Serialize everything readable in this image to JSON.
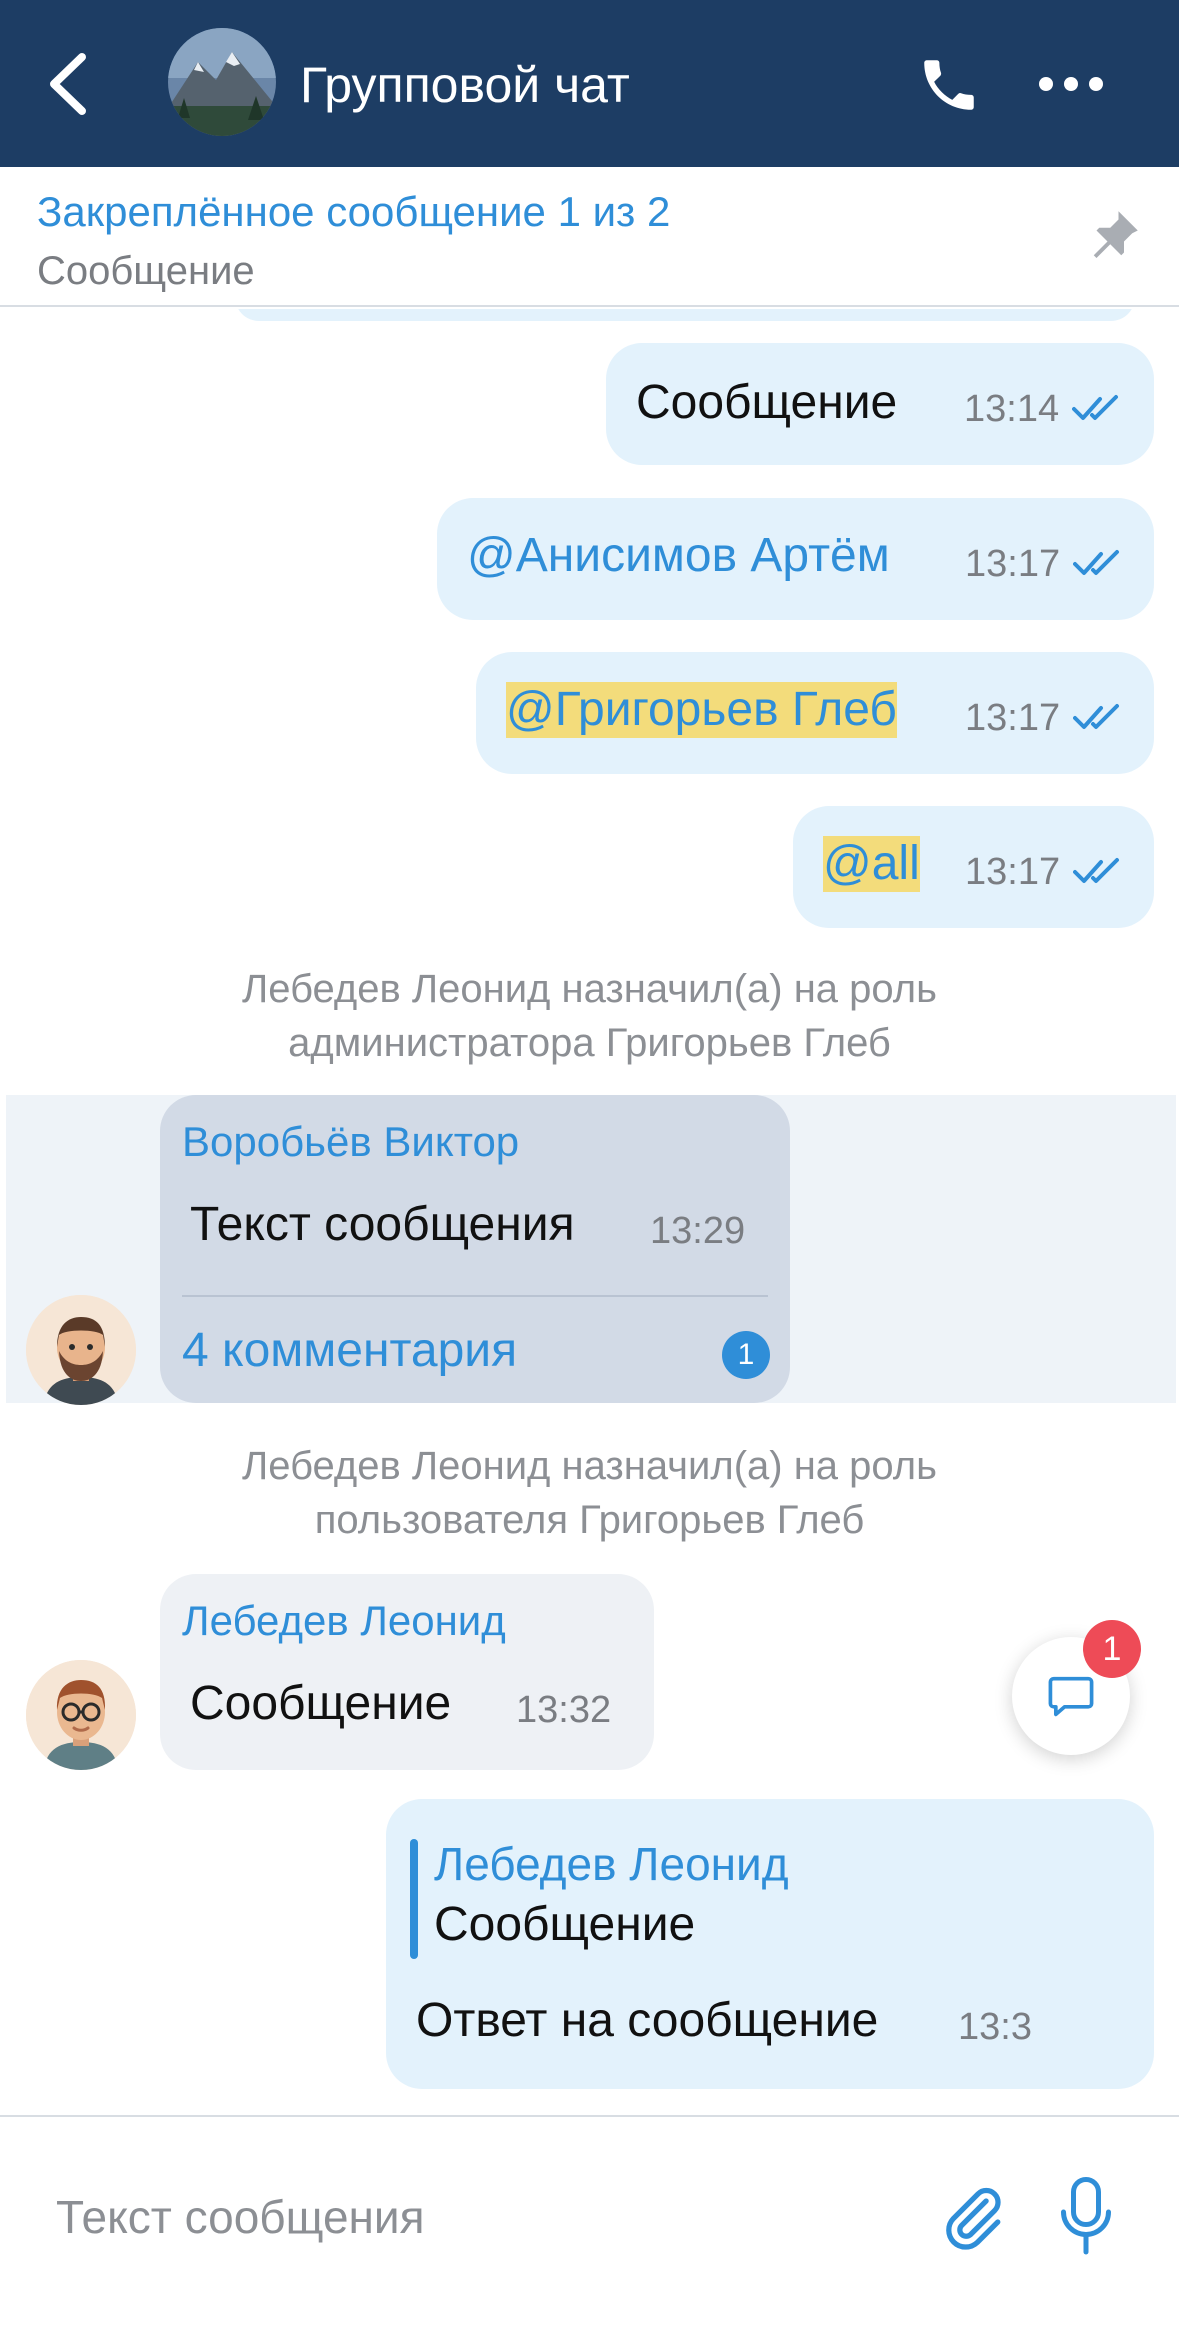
{
  "header": {
    "title": "Групповой чат",
    "back_icon": "chevron-left-icon",
    "call_icon": "phone-icon",
    "more_icon": "more-dots-icon"
  },
  "pinned": {
    "title": "Закреплённое сообщение 1 из 2",
    "text": "Сообщение",
    "icon": "pin-icon"
  },
  "messages": {
    "m1": {
      "text": "Сообщение",
      "time": "13:14"
    },
    "m2": {
      "text": "@Анисимов Артём",
      "time": "13:17"
    },
    "m3": {
      "text": "@Григорьев Глеб",
      "time": "13:17"
    },
    "m4": {
      "text": "@all",
      "time": "13:17"
    },
    "system1": {
      "line1": "Лебедев Леонид назначил(а) на роль",
      "line2": "администратора Григорьев Глеб"
    },
    "thread": {
      "sender": "Воробьёв Виктор",
      "text": "Текст сообщения",
      "time": "13:29",
      "comments": "4 комментария",
      "unread": "1"
    },
    "system2": {
      "line1": "Лебедев Леонид назначил(а) на роль",
      "line2": "пользователя Григорьев Глеб"
    },
    "incoming": {
      "sender": "Лебедев Леонид",
      "text": "Сообщение",
      "time": "13:32"
    },
    "reply": {
      "quote_sender": "Лебедев Леонид",
      "quote_text": "Сообщение",
      "text": "Ответ на сообщение",
      "time_partial": "13:3"
    }
  },
  "fab": {
    "badge": "1",
    "icon": "chat-bubble-icon"
  },
  "composer": {
    "placeholder": "Текст сообщения",
    "value": "",
    "attach_icon": "paperclip-icon",
    "mic_icon": "microphone-icon"
  },
  "colors": {
    "header_bg": "#1d3d64",
    "accent": "#2f8ed8",
    "outgoing_bubble": "#e3f2fc",
    "mention_highlight": "#f3dc7b",
    "badge_red": "#ee4b57"
  }
}
